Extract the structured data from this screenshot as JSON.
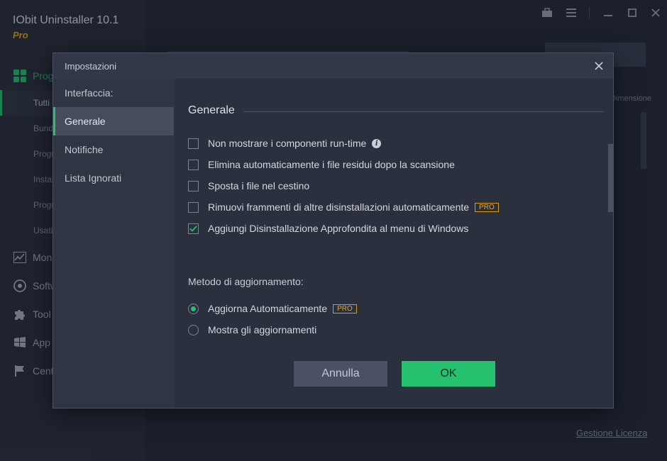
{
  "app": {
    "title": "IObit Uninstaller 10.1",
    "edition": "Pro",
    "nav": [
      {
        "label": "Programmi"
      },
      {
        "label": "Tutti i Programmi"
      },
      {
        "label": "Bundleware"
      },
      {
        "label": "Programmi Recenti"
      },
      {
        "label": "Installazioni grandi"
      },
      {
        "label": "Programmi rari"
      },
      {
        "label": "Usati raramente"
      },
      {
        "label": "Monitor installazioni"
      },
      {
        "label": "Software Health"
      },
      {
        "label": "Tool"
      },
      {
        "label": "App di Windows"
      },
      {
        "label": "Centro azioni"
      }
    ],
    "column_header": "Dimensione",
    "license_link": "Gestione Licenza"
  },
  "dialog": {
    "title": "Impostazioni",
    "sidebar": [
      {
        "label": "Interfaccia:"
      },
      {
        "label": "Generale"
      },
      {
        "label": "Notifiche"
      },
      {
        "label": "Lista Ignorati"
      }
    ],
    "section_title": "Generale",
    "options": [
      {
        "label": "Non mostrare i componenti run-time",
        "checked": false
      },
      {
        "label": "Elimina automaticamente i file residui dopo la scansione",
        "checked": false
      },
      {
        "label": "Sposta i file nel cestino",
        "checked": false
      },
      {
        "label": "Rimuovi frammenti di altre disinstallazioni automaticamente",
        "checked": false
      },
      {
        "label": "Aggiungi Disinstallazione Approfondita al menu di Windows",
        "checked": true
      }
    ],
    "update_method_label": "Metodo di aggiornamento:",
    "update_options": [
      {
        "label": "Aggiorna Automaticamente",
        "selected": true
      },
      {
        "label": "Mostra gli aggiornamenti",
        "selected": false
      }
    ],
    "pro_badge": "PRO",
    "buttons": {
      "cancel": "Annulla",
      "ok": "OK"
    }
  },
  "colors": {
    "accent": "#25c16f",
    "pro": "#e2a72c",
    "background": "#262c39",
    "dialog": "#2a303d"
  }
}
